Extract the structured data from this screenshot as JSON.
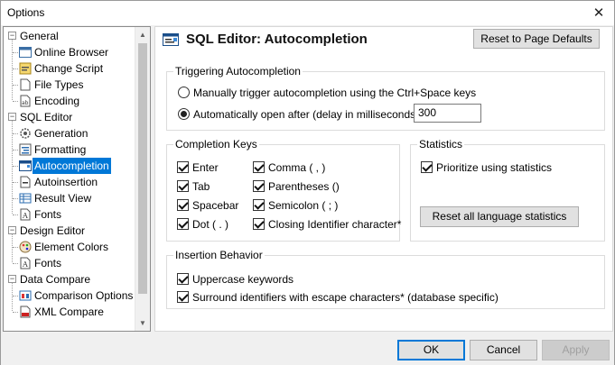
{
  "window": {
    "title": "Options",
    "close_glyph": "✕"
  },
  "tree": {
    "items": [
      {
        "label": "General",
        "level": 0,
        "expander": "−",
        "icon": "none"
      },
      {
        "label": "Online Browser",
        "level": 1,
        "icon": "browser-icon"
      },
      {
        "label": "Change Script",
        "level": 1,
        "icon": "script-icon"
      },
      {
        "label": "File Types",
        "level": 1,
        "icon": "file-icon"
      },
      {
        "label": "Encoding",
        "level": 1,
        "icon": "encoding-icon"
      },
      {
        "label": "SQL Editor",
        "level": 0,
        "expander": "−",
        "icon": "none"
      },
      {
        "label": "Generation",
        "level": 1,
        "icon": "gear-icon"
      },
      {
        "label": "Formatting",
        "level": 1,
        "icon": "formatting-icon"
      },
      {
        "label": "Autocompletion",
        "level": 1,
        "icon": "autocompletion-icon",
        "selected": true
      },
      {
        "label": "Autoinsertion",
        "level": 1,
        "icon": "autoinsertion-icon"
      },
      {
        "label": "Result View",
        "level": 1,
        "icon": "grid-icon"
      },
      {
        "label": "Fonts",
        "level": 1,
        "icon": "font-icon"
      },
      {
        "label": "Design Editor",
        "level": 0,
        "expander": "−",
        "icon": "none"
      },
      {
        "label": "Element Colors",
        "level": 1,
        "icon": "palette-icon"
      },
      {
        "label": "Fonts",
        "level": 1,
        "icon": "font-icon"
      },
      {
        "label": "Data Compare",
        "level": 0,
        "expander": "−",
        "icon": "none"
      },
      {
        "label": "Comparison Options",
        "level": 1,
        "icon": "compare-icon"
      },
      {
        "label": "XML Compare",
        "level": 1,
        "icon": "xml-icon"
      }
    ]
  },
  "page": {
    "title": "SQL Editor: Autocompletion",
    "reset_defaults": "Reset to Page Defaults"
  },
  "triggering": {
    "title": "Triggering Autocompletion",
    "manual_label": "Manually trigger autocompletion using the Ctrl+Space keys",
    "auto_label": "Automatically open after (delay in milliseconds) :",
    "delay_value": "300",
    "selected": "auto"
  },
  "completion_keys": {
    "title": "Completion Keys",
    "keys": [
      {
        "label": "Enter",
        "checked": true
      },
      {
        "label": "Tab",
        "checked": true
      },
      {
        "label": "Spacebar",
        "checked": true
      },
      {
        "label": "Dot ( . )",
        "checked": true
      },
      {
        "label": "Comma ( , )",
        "checked": true
      },
      {
        "label": "Parentheses ()",
        "checked": true
      },
      {
        "label": "Semicolon ( ; )",
        "checked": true
      },
      {
        "label": "Closing Identifier character*",
        "checked": true
      }
    ]
  },
  "statistics": {
    "title": "Statistics",
    "prioritize_label": "Prioritize using statistics",
    "reset_label": "Reset all language statistics"
  },
  "insertion": {
    "title": "Insertion Behavior",
    "uppercase_label": "Uppercase keywords",
    "surround_label": "Surround identifiers with escape characters* (database specific)"
  },
  "dialog": {
    "ok": "OK",
    "cancel": "Cancel",
    "apply": "Apply"
  },
  "colors": {
    "accent": "#0078d7"
  }
}
